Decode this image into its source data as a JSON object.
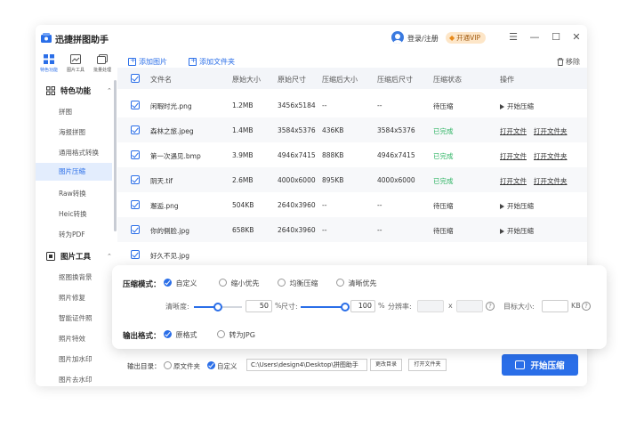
{
  "app": {
    "title": "迅捷拼图助手",
    "login": "登录/注册",
    "vip": "开通VIP",
    "accent": "#2a6ee8"
  },
  "topnav": [
    {
      "label": "特色功能",
      "icon": "grid-icon"
    },
    {
      "label": "图片工具",
      "icon": "image-tool-icon"
    },
    {
      "label": "批量处理",
      "icon": "batch-icon"
    }
  ],
  "sidebar": {
    "group1": "特色功能",
    "items1": [
      "拼图",
      "海报拼图",
      "通用格式转换",
      "图片压缩",
      "Raw转换",
      "Heic转换",
      "转为PDF"
    ],
    "group2": "图片工具",
    "items2": [
      "抠图换背景",
      "照片修复",
      "智能证件照",
      "照片特效",
      "图片加水印",
      "图片去水印"
    ]
  },
  "toolbar": {
    "add_image": "添加图片",
    "add_folder": "添加文件夹",
    "remove": "移除"
  },
  "table": {
    "headers": [
      "文件名",
      "原始大小",
      "原始尺寸",
      "压缩后大小",
      "压缩后尺寸",
      "压缩状态",
      "操作"
    ],
    "rows": [
      {
        "name": "闲暇时光.png",
        "size": "1.2MB",
        "dim": "3456x5184",
        "csize": "--",
        "cdim": "--",
        "status": "待压缩",
        "action": "开始压缩"
      },
      {
        "name": "森林之旅.jpeg",
        "size": "1.4MB",
        "dim": "3584x5376",
        "csize": "436KB",
        "cdim": "3584x5376",
        "status": "已完成",
        "open_file": "打开文件",
        "open_folder": "打开文件夹"
      },
      {
        "name": "第一次遇见.bmp",
        "size": "3.9MB",
        "dim": "4946x7415",
        "csize": "888KB",
        "cdim": "4946x7415",
        "status": "已完成",
        "open_file": "打开文件",
        "open_folder": "打开文件夹"
      },
      {
        "name": "阴天.tif",
        "size": "2.6MB",
        "dim": "4000x6000",
        "csize": "895KB",
        "cdim": "4000x6000",
        "status": "已完成",
        "open_file": "打开文件",
        "open_folder": "打开文件夹"
      },
      {
        "name": "邂逅.png",
        "size": "504KB",
        "dim": "2640x3960",
        "csize": "--",
        "cdim": "--",
        "status": "待压缩",
        "action": "开始压缩"
      },
      {
        "name": "你的側脸.jpg",
        "size": "658KB",
        "dim": "2640x3960",
        "csize": "--",
        "cdim": "--",
        "status": "待压缩",
        "action": "开始压缩"
      },
      {
        "name": "好久不见.jpg"
      }
    ]
  },
  "panel": {
    "mode_label": "压缩模式：",
    "modes": [
      "自定义",
      "缩小优先",
      "均衡压缩",
      "清晰优先"
    ],
    "clarity_label": "清晰度:",
    "clarity_value": "50",
    "clarity_fraction": 0.5,
    "percent": "%",
    "size_label": "尺寸:",
    "size_value": "100",
    "size_fraction": 1.0,
    "resolution_label": "分辨率:",
    "x_sep": "x",
    "target_label": "目标大小:",
    "kb": "KB",
    "format_label": "输出格式：",
    "formats": [
      "原格式",
      "转为JPG"
    ]
  },
  "footer": {
    "output_label": "输出目录：",
    "opt_source": "原文件夹",
    "opt_custom": "自定义",
    "path": "C:\\Users\\design4\\Desktop\\拼图助手",
    "change_btn": "更改目录",
    "open_btn": "打开文件夹",
    "start_btn": "开始压缩"
  }
}
